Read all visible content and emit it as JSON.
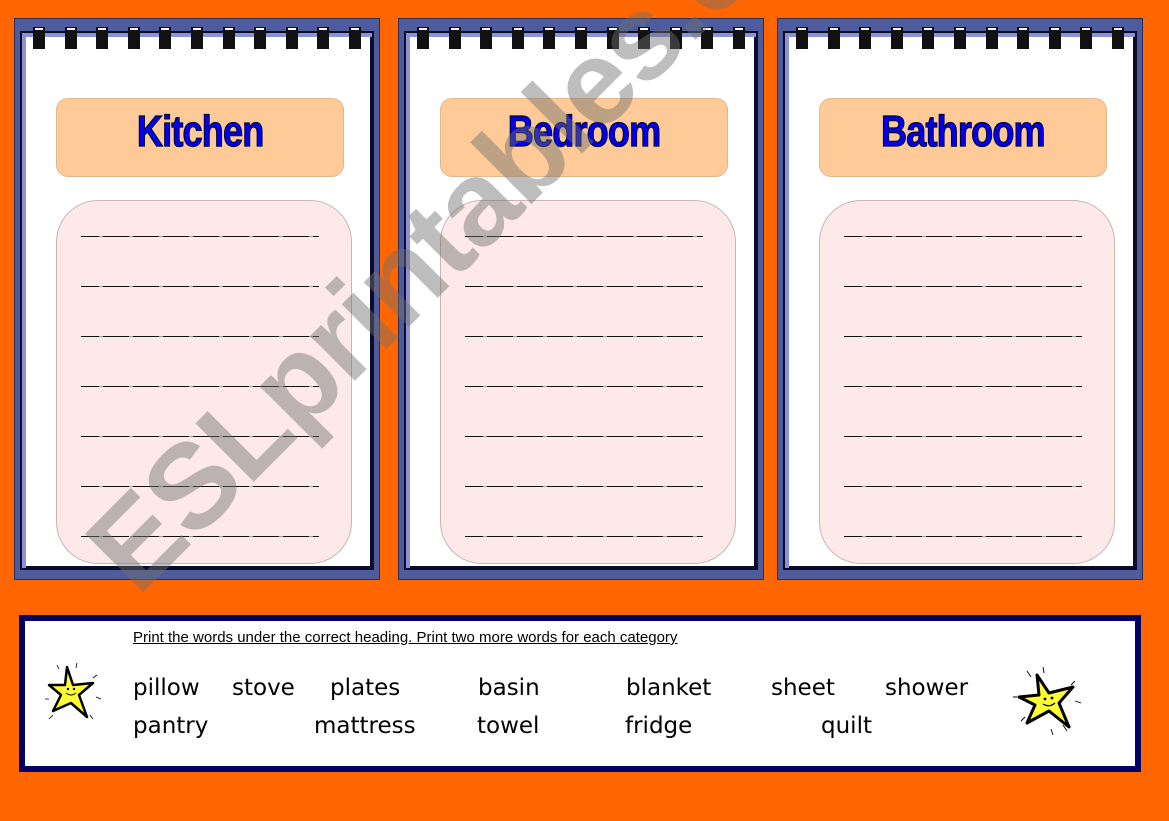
{
  "notepads": [
    {
      "title": "Kitchen",
      "lines": 7
    },
    {
      "title": "Bedroom",
      "lines": 7
    },
    {
      "title": "Bathroom",
      "lines": 7
    }
  ],
  "word_bank": {
    "instruction": "Print the words under the correct heading. Print two more words for each category",
    "row1": [
      "pillow",
      "stove",
      "plates",
      "basin",
      "blanket",
      "sheet",
      "shower"
    ],
    "row2": [
      "pantry",
      "mattress",
      "towel",
      "fridge",
      "quilt"
    ]
  },
  "watermark": "ESLprintables.com",
  "colors": {
    "background": "#ff6600",
    "notepad_frame": "#4e5c9e",
    "heading_box": "#fecb98",
    "heading_text": "#0000ee",
    "writing_area": "#fde9e9",
    "word_bank_border": "#000066",
    "star": "#ffff33"
  }
}
